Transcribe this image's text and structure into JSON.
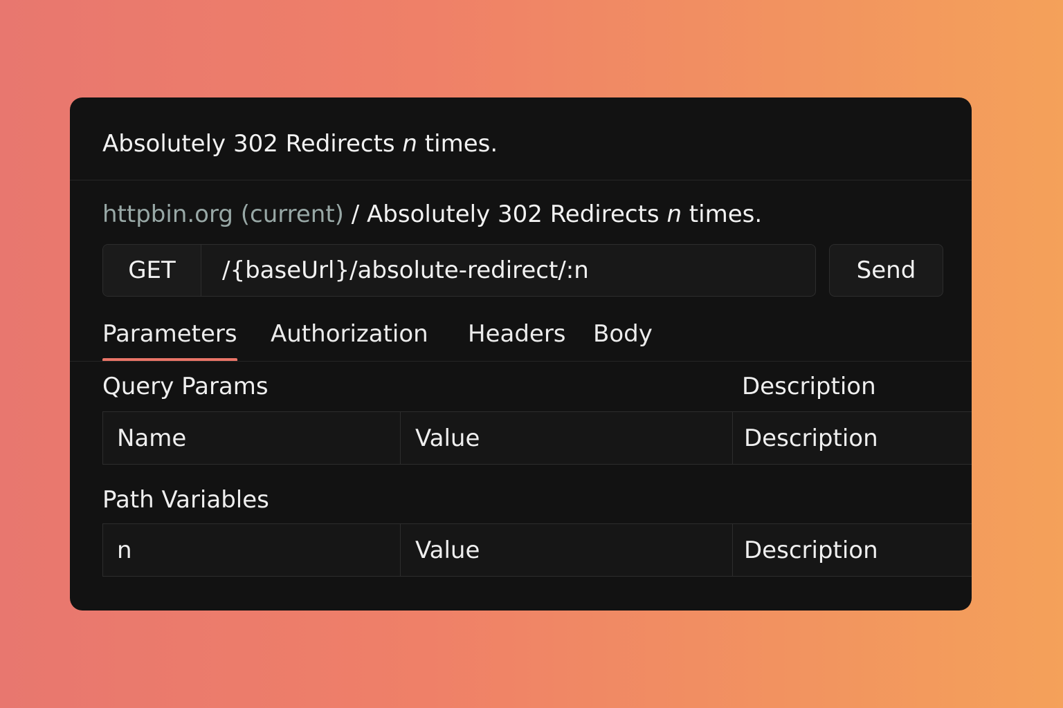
{
  "request": {
    "title_prefix": "Absolutely 302 Redirects ",
    "title_var": "n",
    "title_suffix": " times."
  },
  "breadcrumb": {
    "environment": "httpbin.org (current)",
    "separator": " / ",
    "request_prefix": "Absolutely 302 Redirects ",
    "request_var": "n",
    "request_suffix": " times."
  },
  "urlbar": {
    "method": "GET",
    "url": "/{baseUrl}/absolute-redirect/:n",
    "send_label": "Send"
  },
  "tabs": [
    {
      "label": "Parameters",
      "active": true
    },
    {
      "label": "Authorization",
      "active": false
    },
    {
      "label": "Headers",
      "active": false
    },
    {
      "label": "Body",
      "active": false
    }
  ],
  "query_params": {
    "heading": "Query Params",
    "description_heading": "Description",
    "row": {
      "name": "Name",
      "value": "Value",
      "description": "Description"
    }
  },
  "path_variables": {
    "heading": "Path Variables",
    "row": {
      "name": "n",
      "value": "Value",
      "description": "Description"
    }
  },
  "colors": {
    "accent": "#ea7568",
    "panel_bg": "#121212",
    "environment_text": "#98a8a6"
  }
}
